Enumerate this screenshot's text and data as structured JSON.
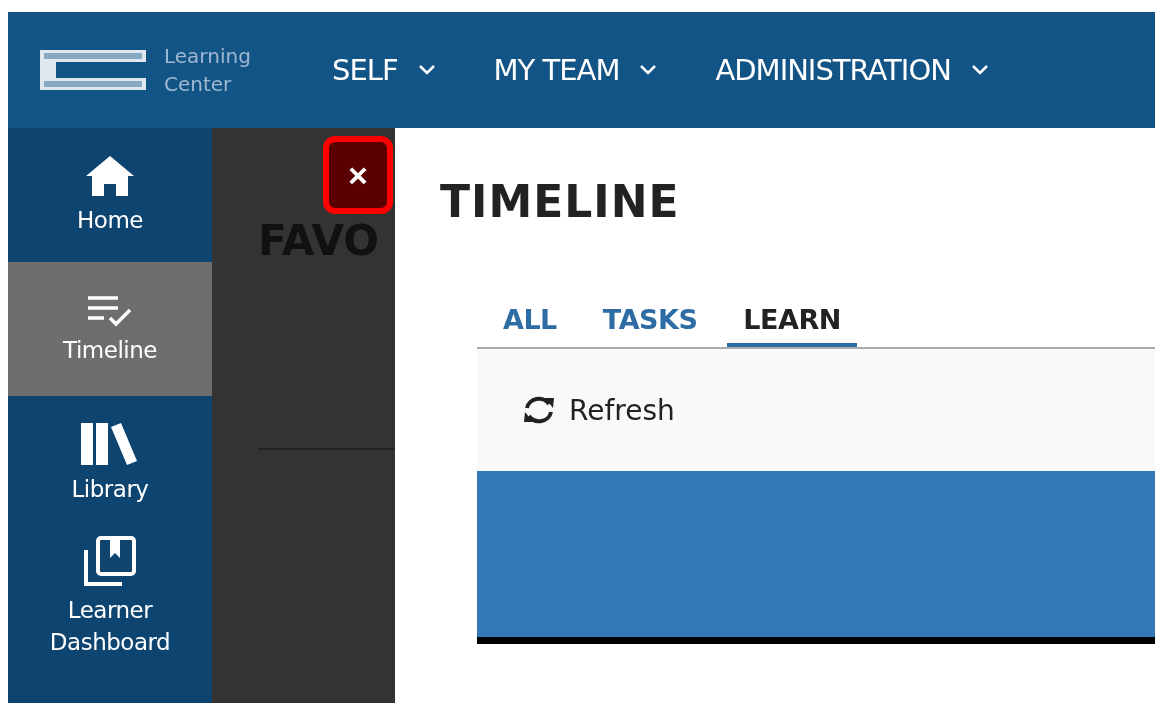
{
  "header": {
    "brand": [
      "Learning",
      "Center"
    ],
    "nav": [
      {
        "label": "SELF"
      },
      {
        "label": "MY TEAM"
      },
      {
        "label": "ADMINISTRATION"
      }
    ]
  },
  "sidebar": {
    "items": [
      {
        "kind": "home",
        "label": "Home",
        "selected": false
      },
      {
        "kind": "timeline",
        "label": "Timeline",
        "selected": true
      },
      {
        "kind": "library",
        "label": "Library",
        "selected": false
      },
      {
        "kind": "dashboard",
        "label": "Learner Dashboard",
        "selected": false
      }
    ]
  },
  "background_page": {
    "heading": "FAVO"
  },
  "panel": {
    "close": "×",
    "title": "TIMELINE",
    "tabs": [
      {
        "label": "ALL",
        "selected": false
      },
      {
        "label": "TASKS",
        "selected": false
      },
      {
        "label": "LEARN",
        "selected": true
      }
    ],
    "toolbar": {
      "refresh": "Refresh"
    }
  }
}
